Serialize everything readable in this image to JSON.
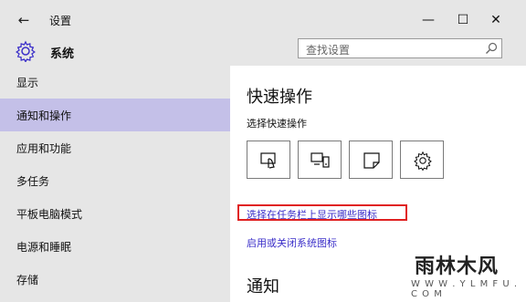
{
  "window": {
    "back_glyph": "←",
    "title": "设置",
    "minimize_glyph": "—",
    "maximize_glyph": "☐",
    "close_glyph": "✕"
  },
  "header": {
    "gear_icon": "gear-icon",
    "title": "系统"
  },
  "search": {
    "placeholder": "查找设置",
    "icon": "search-icon"
  },
  "sidebar": {
    "items": [
      {
        "label": "显示",
        "active": false
      },
      {
        "label": "通知和操作",
        "active": true
      },
      {
        "label": "应用和功能",
        "active": false
      },
      {
        "label": "多任务",
        "active": false
      },
      {
        "label": "平板电脑模式",
        "active": false
      },
      {
        "label": "电源和睡眠",
        "active": false
      },
      {
        "label": "存储",
        "active": false
      }
    ]
  },
  "main": {
    "title": "快速操作",
    "subtitle": "选择快速操作",
    "quick_actions": [
      {
        "icon": "tablet-mode-icon"
      },
      {
        "icon": "connect-icon"
      },
      {
        "icon": "note-icon"
      },
      {
        "icon": "settings-icon"
      }
    ],
    "link_taskbar_icons": "选择在任务栏上显示哪些图标",
    "link_system_icons": "启用或关闭系统图标",
    "notify_title": "通知"
  },
  "watermark": {
    "brand": "雨林木风",
    "url": "W W W . Y L M F U . C O M"
  },
  "colors": {
    "chrome_bg": "#e6e6e6",
    "selected_bg": "#c4c0e8",
    "link": "#3b2fc9",
    "highlight_box": "#e02020"
  }
}
